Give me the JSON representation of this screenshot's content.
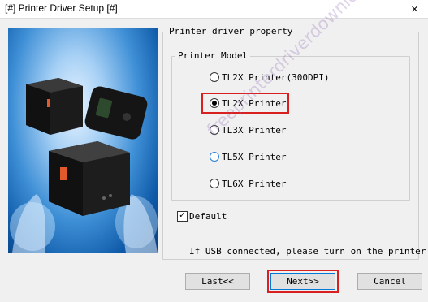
{
  "window": {
    "title": "[#] Printer Driver Setup [#]",
    "close_glyph": "×"
  },
  "banner": {
    "image": "printer-product-illustration"
  },
  "property_group": {
    "label": "Printer driver property"
  },
  "model_group": {
    "label": "Printer Model",
    "options": [
      {
        "label": "TL2X Printer(300DPI)",
        "selected": false
      },
      {
        "label": "TL2X Printer",
        "selected": true
      },
      {
        "label": "TL3X Printer",
        "selected": false
      },
      {
        "label": "TL5X Printer",
        "selected": false
      },
      {
        "label": "TL6X Printer",
        "selected": false
      }
    ]
  },
  "default_checkbox": {
    "label": "Default",
    "checked": true,
    "check_glyph": "✓"
  },
  "usb_notice": "If USB connected, please turn on the printer",
  "buttons": {
    "last": "Last<<",
    "next": "Next>>",
    "cancel": "Cancel"
  },
  "watermark": "freeprinterdriverdownload.org",
  "colors": {
    "highlight": "#d92020",
    "focus": "#0078d7"
  }
}
